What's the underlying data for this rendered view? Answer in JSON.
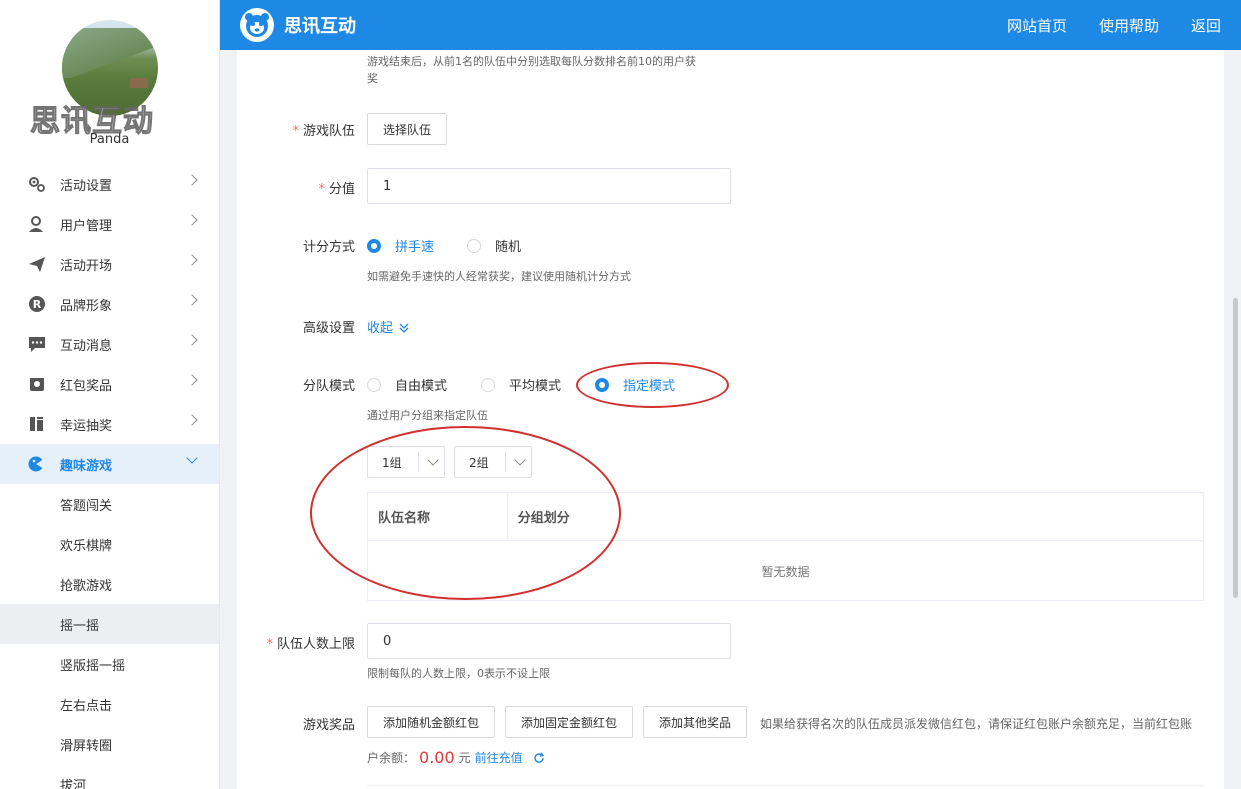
{
  "sidebar": {
    "watermark": "思讯互动",
    "username": "Panda",
    "menu": [
      {
        "label": "活动设置",
        "icon": "gears-icon"
      },
      {
        "label": "用户管理",
        "icon": "user-icon"
      },
      {
        "label": "活动开场",
        "icon": "paper-plane-icon"
      },
      {
        "label": "品牌形象",
        "icon": "registered-icon"
      },
      {
        "label": "互动消息",
        "icon": "chat-icon"
      },
      {
        "label": "红包奖品",
        "icon": "gift-icon"
      },
      {
        "label": "幸运抽奖",
        "icon": "lottery-icon"
      },
      {
        "label": "趣味游戏",
        "icon": "gamepad-icon"
      }
    ],
    "submenu": [
      "答题闯关",
      "欢乐棋牌",
      "抢歌游戏",
      "摇一摇",
      "竖版摇一摇",
      "左右点击",
      "滑屏转圈",
      "拔河"
    ]
  },
  "topbar": {
    "brand": "思讯互动",
    "links": [
      "网站首页",
      "使用帮助",
      "返回"
    ]
  },
  "form": {
    "top_hint_line1": "游戏结束后，从前1名的队伍中分别选取每队分数排名前10的用户获",
    "top_hint_line2": "奖",
    "team_label": "游戏队伍",
    "team_button": "选择队伍",
    "score_label": "分值",
    "score_value": "1",
    "scoring_label": "计分方式",
    "scoring_options": [
      "拼手速",
      "随机"
    ],
    "scoring_hint": "如需避免手速快的人经常获奖，建议使用随机计分方式",
    "advanced_label": "高级设置",
    "advanced_toggle": "收起",
    "group_mode_label": "分队模式",
    "group_mode_options": [
      "自由模式",
      "平均模式",
      "指定模式"
    ],
    "group_mode_hint": "通过用户分组来指定队伍",
    "group_selects": [
      "1组",
      "2组"
    ],
    "table_headers": [
      "队伍名称",
      "分组划分"
    ],
    "table_empty": "暂无数据",
    "limit_label": "队伍人数上限",
    "limit_value": "0",
    "limit_hint": "限制每队的人数上限，0表示不设上限",
    "prize_label": "游戏奖品",
    "prize_buttons": [
      "添加随机金额红包",
      "添加固定金额红包",
      "添加其他奖品"
    ],
    "prize_hint": "如果给获得名次的队伍成员派发微信红包，请保证红包账户余额充足，当前红包账",
    "balance_prefix": "户余额：",
    "balance_value": "0.00",
    "balance_unit": "元",
    "recharge_link": "前往充值"
  },
  "colors": {
    "primary": "#1e88e5",
    "required": "#f56c6c",
    "balance": "#e53935",
    "annotation": "#d32f2f"
  }
}
